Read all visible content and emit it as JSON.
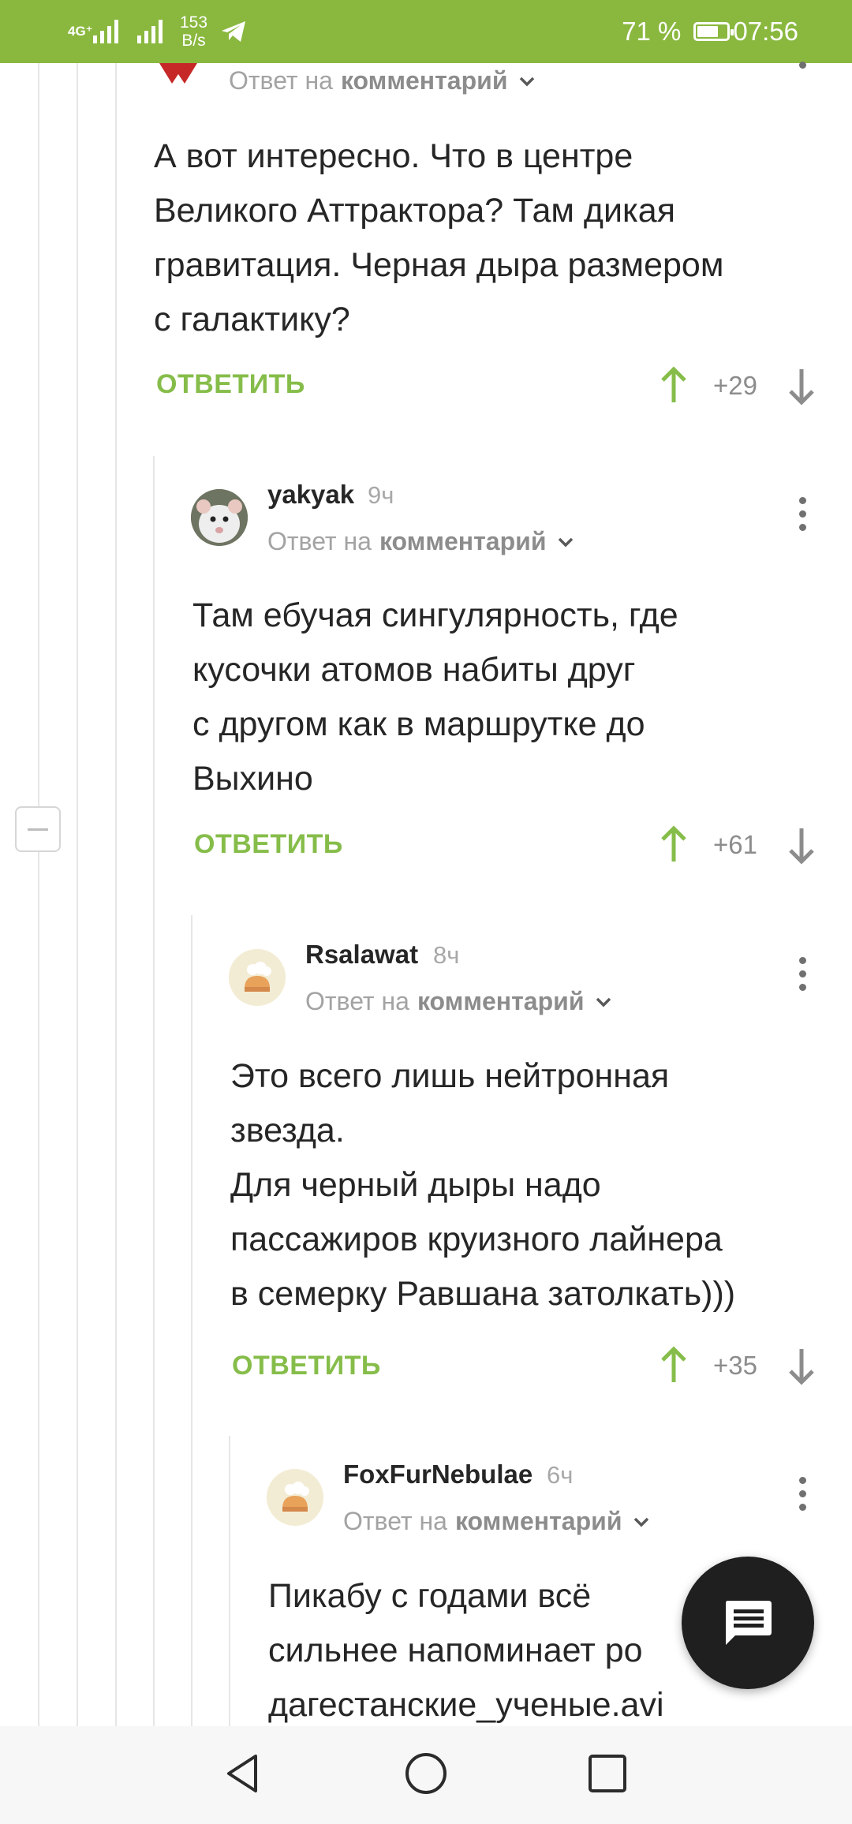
{
  "status_bar": {
    "network": "4G⁺",
    "speed_value": "153",
    "speed_unit": "B/s",
    "battery_text": "71 %",
    "battery_level": 0.71,
    "time": "07:56"
  },
  "colors": {
    "accent_green": "#8ab83f",
    "reply_green": "#86bd4a",
    "up_arrow": "#86bd4a",
    "down_arrow": "#8c8c8c"
  },
  "labels": {
    "reply_to_prefix": "Ответ на",
    "reply_to_target": "комментарий",
    "reply_button": "ОТВЕТИТЬ"
  },
  "comments": [
    {
      "author": "",
      "time": "",
      "text": [
        "А вот интересно. Что в центре",
        "Великого Аттрактора? Там дикая",
        "гравитация. Черная дыра размером",
        "с галактику?"
      ],
      "score": "+29"
    },
    {
      "author": "yakyak",
      "time": "9ч",
      "text": [
        "Там ебучая сингулярность, где",
        "кусочки атомов набиты друг",
        "с другом как в маршрутке до",
        "Выхино"
      ],
      "score": "+61"
    },
    {
      "author": "Rsalawat",
      "time": "8ч",
      "text": [
        "Это всего лишь нейтронная",
        "звезда.",
        "Для черный дыры надо",
        "пассажиров круизного лайнера",
        "в семерку Равшана затолкать)))"
      ],
      "score": "+35"
    },
    {
      "author": "FoxFurNebulae",
      "time": "6ч",
      "text": [
        "Пикабу с годами всё",
        "сильнее напоминает ро",
        "дагестанские_ученые.avi"
      ],
      "score": ""
    }
  ],
  "icons": {
    "fab": "chat-icon",
    "nav": [
      "back-icon",
      "home-icon",
      "recents-icon"
    ]
  }
}
